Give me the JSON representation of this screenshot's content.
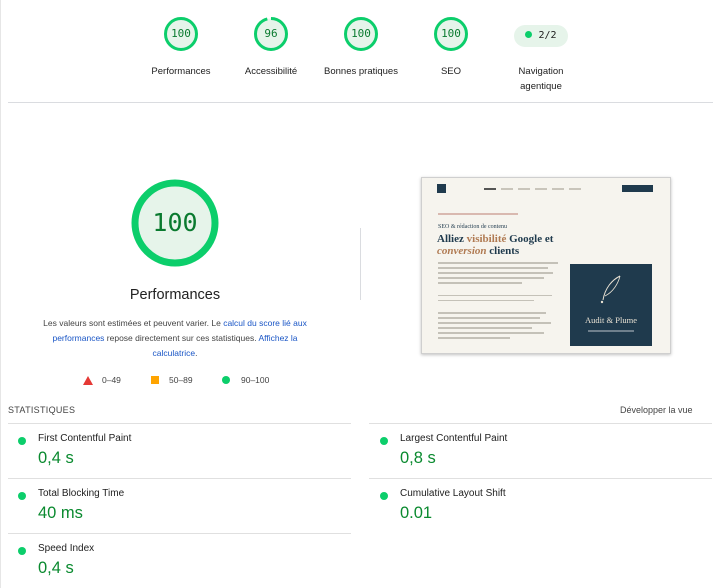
{
  "colors": {
    "pass_green": "#0cce6b",
    "pass_text": "#0a8a2f",
    "average_orange": "#ffa400",
    "fail_red": "#e53935",
    "link_blue": "#1a56c6"
  },
  "categories": [
    {
      "label": "Performances",
      "score": "100",
      "fraction": 1.0
    },
    {
      "label": "Accessibilité",
      "score": "96",
      "fraction": 0.96
    },
    {
      "label": "Bonnes pratiques",
      "score": "100",
      "fraction": 1.0
    },
    {
      "label": "SEO",
      "score": "100",
      "fraction": 1.0
    }
  ],
  "agentic": {
    "label_line1": "Navigation",
    "label_line2": "agentique",
    "badge": "2/2"
  },
  "main": {
    "score": "100",
    "fraction": 1.0,
    "title": "Performances",
    "desc_part1": "Les valeurs sont estimées et peuvent varier. Le ",
    "desc_link1": "calcul du score lié aux performances",
    "desc_part2": " repose directement sur ces statistiques. ",
    "desc_link2": "Affichez la calculatrice",
    "desc_end": "."
  },
  "legend": {
    "fail": "0–49",
    "average": "50–89",
    "pass": "90–100"
  },
  "thumbnail": {
    "kicker": "SEO & rédaction de contenu",
    "heading_a": "Alliez ",
    "heading_b": "visibilité",
    "heading_c": " Google et ",
    "heading_d": "conversion",
    "heading_e": " clients",
    "brand": "Audit & Plume"
  },
  "stats": {
    "heading": "STATISTIQUES",
    "toggle": "Développer la vue",
    "metrics": [
      {
        "name": "First Contentful Paint",
        "value": "0,4 s"
      },
      {
        "name": "Largest Contentful Paint",
        "value": "0,8 s"
      },
      {
        "name": "Total Blocking Time",
        "value": "40 ms"
      },
      {
        "name": "Cumulative Layout Shift",
        "value": "0.01"
      },
      {
        "name": "Speed Index",
        "value": "0,4 s"
      }
    ]
  }
}
